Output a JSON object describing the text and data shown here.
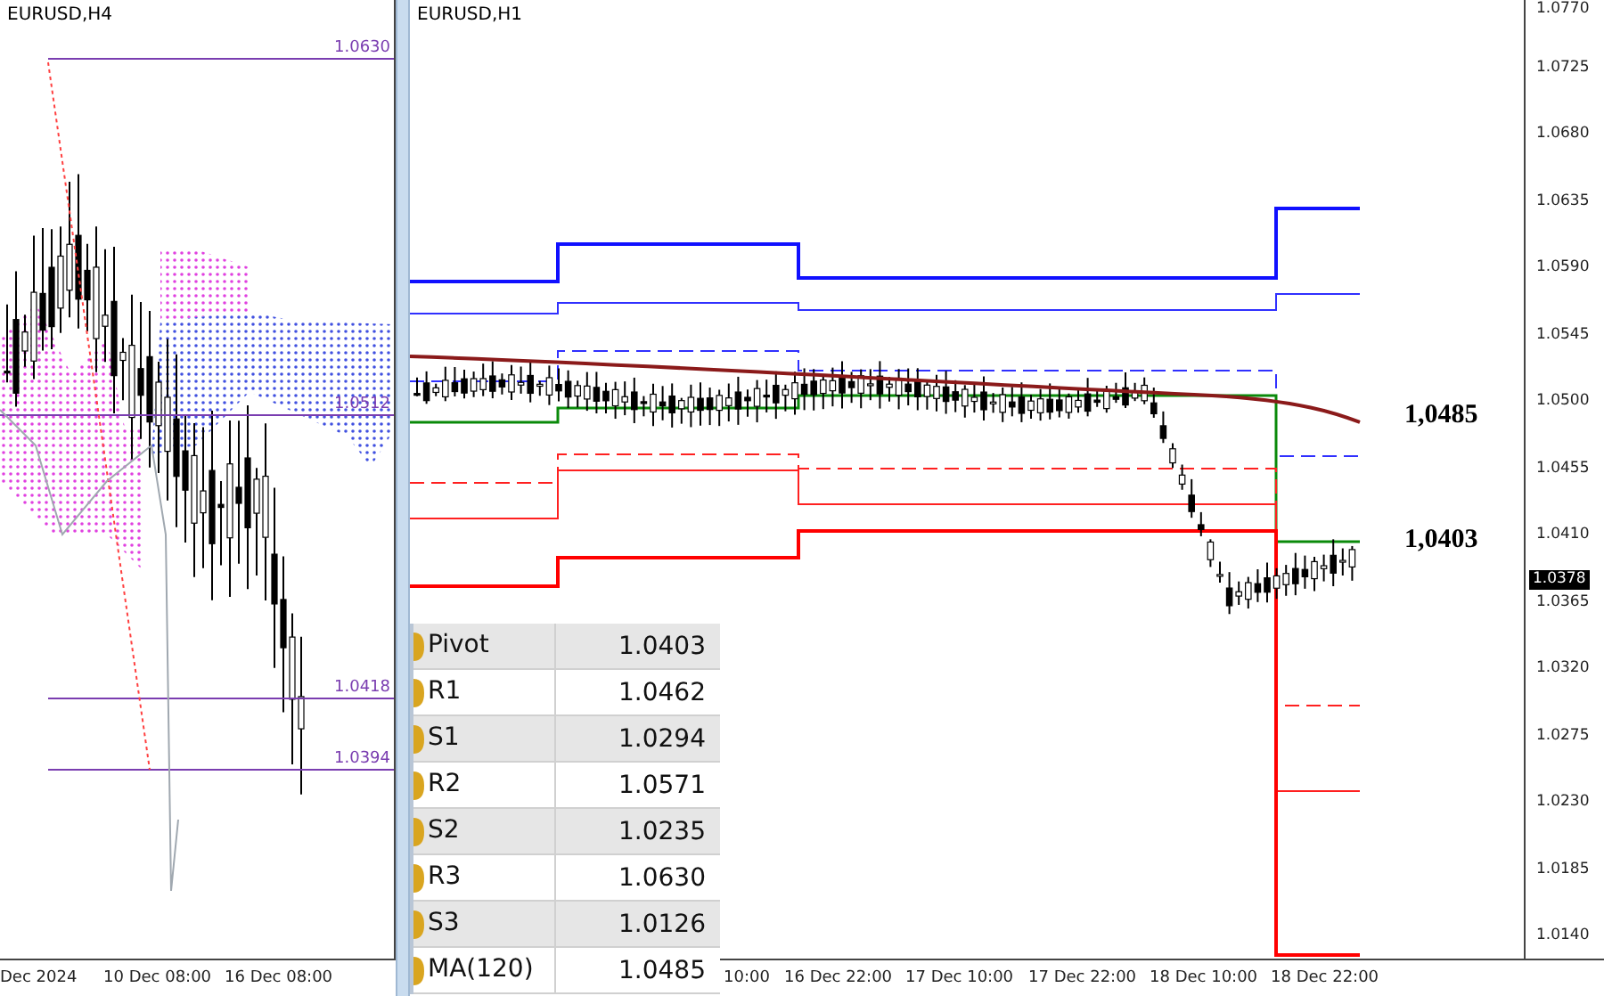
{
  "left_chart": {
    "title": "EURUSD,H4",
    "level_labels": [
      "1.0630",
      "1.0512",
      "1.0418",
      "1.0394"
    ],
    "time_labels": [
      "Dec 2024",
      "10 Dec 08:00",
      "16 Dec 08:00"
    ]
  },
  "right_chart": {
    "title": "EURUSD,H1",
    "price_axis": [
      "1.0770",
      "1.0725",
      "1.0680",
      "1.0635",
      "1.0590",
      "1.0545",
      "1.0500",
      "1.0455",
      "1.0410",
      "1.0365",
      "1.0320",
      "1.0275",
      "1.0230",
      "1.0185",
      "1.0140"
    ],
    "current_price": "1.0378",
    "annotations": [
      "1,0485",
      "1,0403"
    ],
    "time_labels": [
      "10:00",
      "16 Dec 22:00",
      "17 Dec 10:00",
      "17 Dec 22:00",
      "18 Dec 10:00",
      "18 Dec 22:00"
    ]
  },
  "levels_table": {
    "rows": [
      {
        "name": "Pivot",
        "value": "1.0403"
      },
      {
        "name": "R1",
        "value": "1.0462"
      },
      {
        "name": "S1",
        "value": "1.0294"
      },
      {
        "name": "R2",
        "value": "1.0571"
      },
      {
        "name": "S2",
        "value": "1.0235"
      },
      {
        "name": "R3",
        "value": "1.0630"
      },
      {
        "name": "S3",
        "value": "1.0126"
      },
      {
        "name": "MA(120)",
        "value": "1.0485"
      }
    ]
  }
}
